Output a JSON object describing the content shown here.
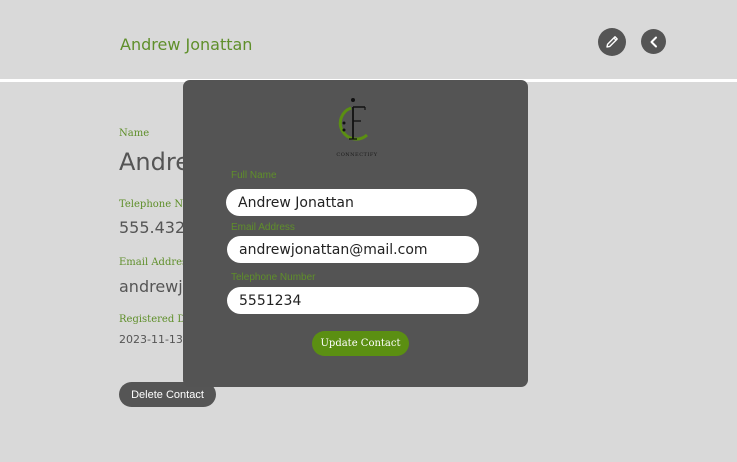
{
  "header": {
    "contact_name": "Andrew Jonattan"
  },
  "icons": {
    "edit": "pencil-icon",
    "back": "chevron-left-icon"
  },
  "details": {
    "name_label": "Name",
    "name_value": "Andrew Jonattan",
    "telephone_label": "Telephone Number",
    "telephone_value": "555.4324",
    "email_label": "Email Address",
    "email_value": "andrewjonattan@mail.com",
    "registered_label": "Registered Date",
    "registered_value": "2023-11-13",
    "delete_label": "Delete Contact"
  },
  "modal": {
    "logo_text": "CONNECTIFY",
    "full_name_label": "Full Name",
    "full_name_value": "Andrew Jonattan",
    "email_label": "Email Address",
    "email_value": "andrewjonattan@mail.com",
    "telephone_label": "Telephone Number",
    "telephone_value": "5551234",
    "update_label": "Update Contact"
  },
  "colors": {
    "accent_green": "#5f8f2a",
    "button_green": "#5b8f12",
    "dark_gray": "#555555",
    "background": "#d9d9d9"
  }
}
